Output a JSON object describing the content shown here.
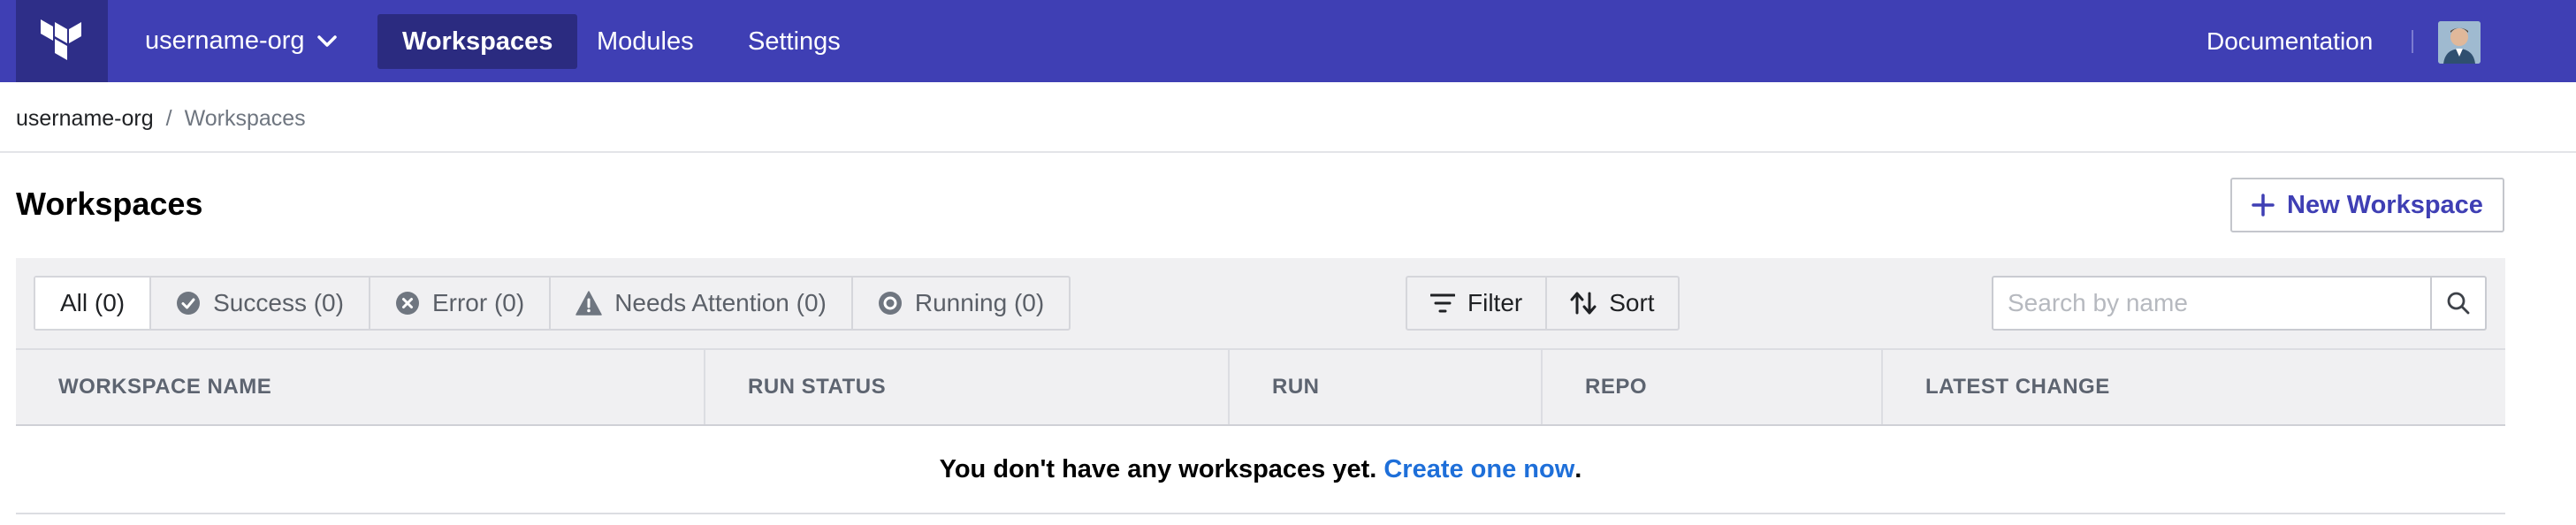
{
  "nav": {
    "logo_icon": "terraform-logo-icon",
    "org_name": "username-org",
    "items": [
      {
        "label": "Workspaces",
        "active": true
      },
      {
        "label": "Modules",
        "active": false
      },
      {
        "label": "Settings",
        "active": false
      }
    ],
    "documentation": "Documentation",
    "avatar_icon": "user-avatar"
  },
  "breadcrumb": {
    "org": "username-org",
    "separator": "/",
    "current": "Workspaces"
  },
  "page": {
    "title": "Workspaces",
    "new_button": "New Workspace"
  },
  "filters": {
    "tabs": [
      {
        "label": "All (0)",
        "icon": "",
        "active": true
      },
      {
        "label": "Success (0)",
        "icon": "check-circle-icon",
        "active": false
      },
      {
        "label": "Error (0)",
        "icon": "x-circle-icon",
        "active": false
      },
      {
        "label": "Needs Attention (0)",
        "icon": "warning-icon",
        "active": false
      },
      {
        "label": "Running (0)",
        "icon": "running-circle-icon",
        "active": false
      }
    ],
    "filter_label": "Filter",
    "sort_label": "Sort",
    "search_placeholder": "Search by name"
  },
  "table": {
    "columns": [
      "WORKSPACE NAME",
      "RUN STATUS",
      "RUN",
      "REPO",
      "LATEST CHANGE"
    ],
    "empty_text": "You don't have any workspaces yet.",
    "empty_link": "Create one now",
    "empty_suffix": "."
  },
  "colors": {
    "nav_bg": "#3f3fb4",
    "nav_active_bg": "#2b2b80",
    "accent": "#3f3fb4",
    "link": "#1e6fd9"
  }
}
